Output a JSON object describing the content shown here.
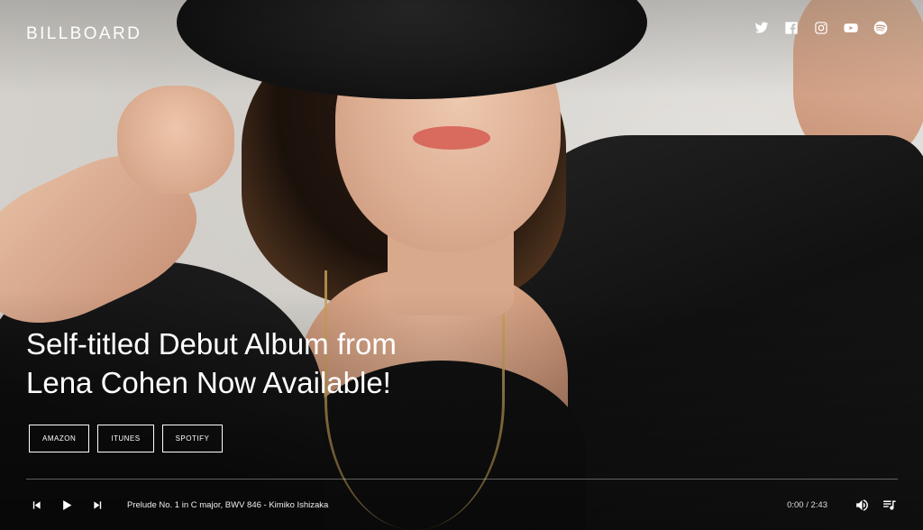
{
  "header": {
    "logo": "BILLBOARD",
    "social": [
      "twitter-icon",
      "facebook-icon",
      "instagram-icon",
      "youtube-icon",
      "spotify-icon"
    ]
  },
  "hero": {
    "headline_line1": "Self-titled Debut Album from",
    "headline_line2": "Lena Cohen Now Available!",
    "stores": [
      "AMAZON",
      "ITUNES",
      "SPOTIFY"
    ]
  },
  "player": {
    "track": "Prelude No. 1 in C major, BWV 846 - Kimiko Ishizaka",
    "time": "0:00 / 2:43",
    "icons": [
      "previous-icon",
      "play-icon",
      "next-icon",
      "volume-icon",
      "playlist-icon"
    ]
  },
  "colors": {
    "text": "#ffffff",
    "accent": "#ffffff",
    "background": "#1a1a1a"
  }
}
